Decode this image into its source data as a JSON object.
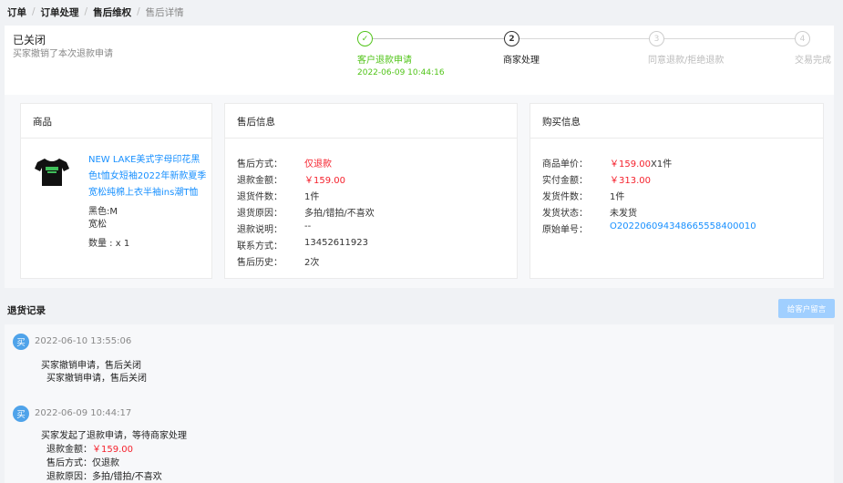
{
  "breadcrumb": {
    "items": [
      "订单",
      "订单处理",
      "售后维权"
    ],
    "current": "售后详情",
    "separator": "/"
  },
  "status": {
    "title": "已关闭",
    "subtitle": "买家撤销了本次退款申请"
  },
  "steps": [
    {
      "num": "✓",
      "label": "客户退款申请",
      "time": "2022-06-09 10:44:16",
      "state": "done"
    },
    {
      "num": "2",
      "label": "商家处理",
      "time": "",
      "state": "active"
    },
    {
      "num": "3",
      "label": "同意退款/拒绝退款",
      "time": "",
      "state": "pending"
    },
    {
      "num": "4",
      "label": "交易完成",
      "time": "",
      "state": "pending"
    }
  ],
  "product": {
    "heading": "商品",
    "title_lines": [
      "NEW LAKE美式字母印花黑",
      "色t恤女短袖2022年新款夏季",
      "宽松纯棉上衣半袖ins潮T恤"
    ],
    "color": "黑色:M",
    "fit": "宽松",
    "quantity": "数量 : x 1"
  },
  "aftersale": {
    "heading": "售后信息",
    "rows": [
      {
        "k": "售后方式：",
        "v": "仅退款",
        "tone": "red"
      },
      {
        "k": "退款金额：",
        "v": "￥159.00",
        "tone": "red"
      },
      {
        "k": "退货件数：",
        "v": "1件",
        "tone": ""
      },
      {
        "k": "退货原因：",
        "v": "多拍/错拍/不喜欢",
        "tone": ""
      },
      {
        "k": "退款说明：",
        "v": "--",
        "tone": ""
      },
      {
        "k": "联系方式：",
        "v": "13452611923",
        "tone": ""
      },
      {
        "k": "售后历史：",
        "v": "2次",
        "tone": ""
      }
    ]
  },
  "purchase": {
    "heading": "购买信息",
    "rows": [
      {
        "k": "商品单价：",
        "v": "￥159.00",
        "v2": "X1件",
        "tone": "red"
      },
      {
        "k": "实付金额：",
        "v": "￥313.00",
        "v2": "",
        "tone": "red"
      },
      {
        "k": "发货件数：",
        "v": "1件",
        "v2": "",
        "tone": ""
      },
      {
        "k": "发货状态：",
        "v": "未发货",
        "v2": "",
        "tone": ""
      },
      {
        "k": "原始单号：",
        "v": "O202206094348665558400010",
        "v2": "",
        "tone": "blue"
      }
    ]
  },
  "records": {
    "title": "退货记录",
    "message_button": "给客户留言",
    "entries": [
      {
        "badge": "买",
        "time": "2022-06-10 13:55:06",
        "lines": [
          "买家撤销申请，售后关闭",
          "买家撤销申请，售后关闭"
        ]
      },
      {
        "badge": "买",
        "time": "2022-06-09 10:44:17",
        "lines": [
          "买家发起了退款申请，等待商家处理",
          "退款金额：",
          "售后方式：仅退款",
          "退款原因：多拍/错拍/不喜欢"
        ],
        "amount": "￥159.00"
      }
    ]
  },
  "colors": {
    "accent": "#1890ff",
    "success": "#52c41a",
    "danger": "#f5222d",
    "badge": "#4fa3ea",
    "button_disabled": "#a0cfff"
  }
}
